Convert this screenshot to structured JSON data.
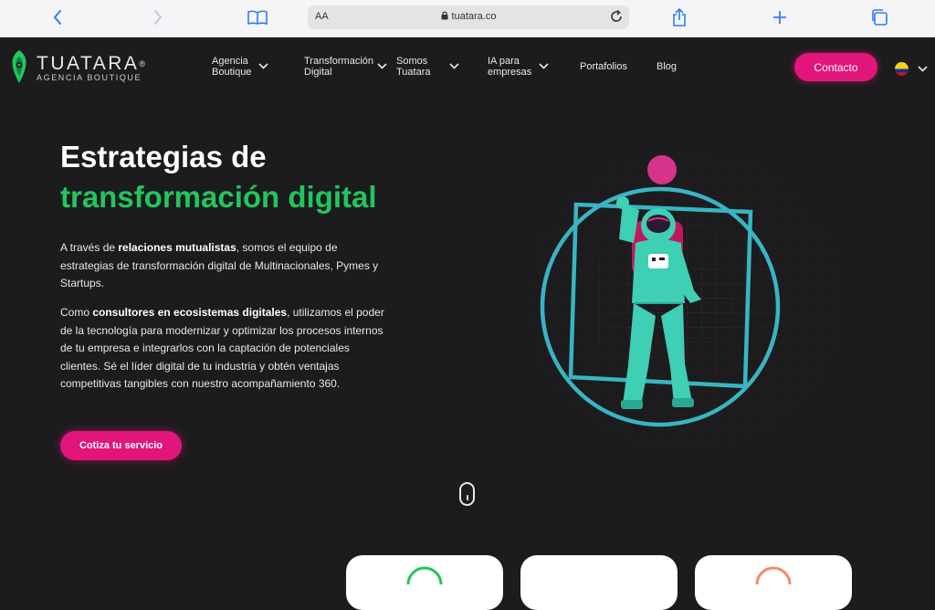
{
  "browser": {
    "aa_label": "AA",
    "url": "tuatara.co"
  },
  "header": {
    "logo_name": "TUATARA",
    "logo_reg": "®",
    "logo_sub": "AGENCIA BOUTIQUE",
    "nav": [
      {
        "label_1": "Agencia",
        "label_2": "Boutique",
        "has_dropdown": true
      },
      {
        "label_1": "Transformación",
        "label_2": "Digital",
        "has_dropdown": true
      },
      {
        "label_1": "Somos",
        "label_2": "Tuatara",
        "has_dropdown": true
      },
      {
        "label_1": "IA para",
        "label_2": "empresas",
        "has_dropdown": true
      },
      {
        "label_1": "Portafolios",
        "label_2": "",
        "has_dropdown": false
      },
      {
        "label_1": "Blog",
        "label_2": "",
        "has_dropdown": false
      }
    ],
    "contact_label": "Contacto",
    "language_flag": "colombia-flag-icon"
  },
  "hero": {
    "title_line1": "Estrategias de",
    "title_line2": "transformación digital",
    "p1_pre": "A través de ",
    "p1_bold": "relaciones mutualistas",
    "p1_post": ", somos el equipo de estrategias de transformación digital de Multinacionales, Pymes y Startups.",
    "p2_pre": "Como ",
    "p2_bold": "consultores en ecosistemas digitales",
    "p2_post": ", utilizamos el poder de la tecnología para modernizar y optimizar los procesos internos de tu empresa e integrarlos con la captación de potenciales clientes. Sé el líder digital de tu industria y obtén ventajas competitivas tangibles con nuestro acompañamiento 360.",
    "cta_label": "Cotiza tu servicio"
  },
  "colors": {
    "background": "#1c1b1d",
    "accent_pink": "#e2157b",
    "accent_green": "#22c55e",
    "astronaut_teal": "#3ecfb4",
    "browser_blue": "#2f7cf6"
  }
}
